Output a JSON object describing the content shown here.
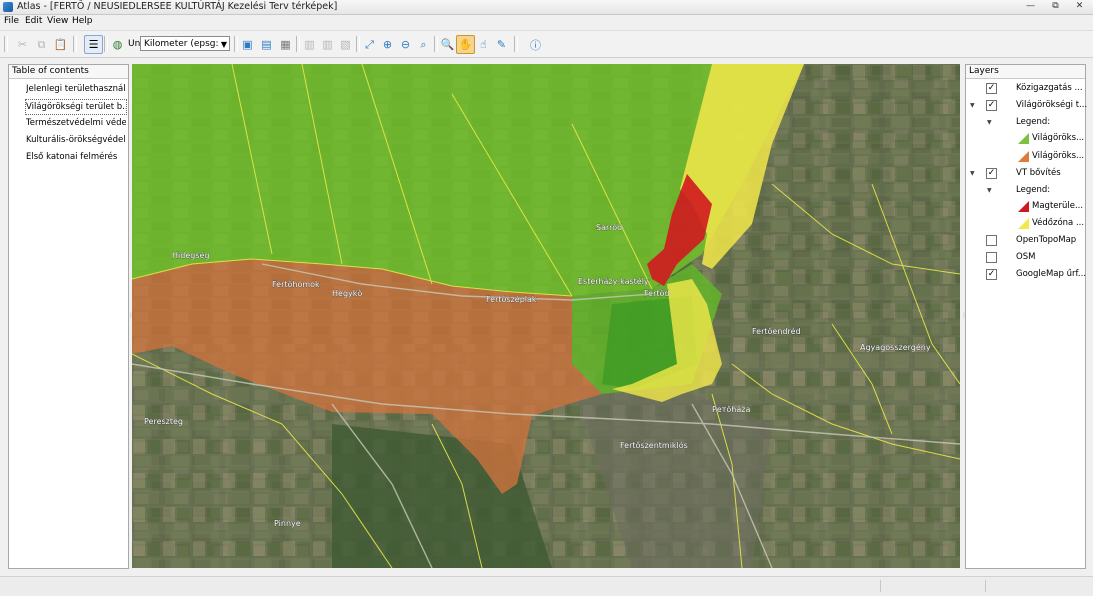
{
  "window": {
    "title": "Atlas - [FERTŐ / NEUSIEDLERSEE KULTÚRTÁJ Kezelési Terv térképek]",
    "controls": [
      "—",
      "⧉",
      "✕"
    ]
  },
  "menu": [
    "File",
    "Edit",
    "View",
    "Help"
  ],
  "toolbar": {
    "unit_label": "Unit:",
    "unit_value": "Kilometer (epsg:"
  },
  "toc": {
    "header": "Table of contents",
    "items": [
      "Jelenlegi területhasználat",
      "Világörökségi terület b...",
      "Természetvédelmi védettség",
      "Kulturális-örökségvédelem",
      "Első katonai felmérés"
    ]
  },
  "layers": {
    "header": "Layers",
    "rows": [
      {
        "label": "Közigazgatás ...",
        "checked": true
      },
      {
        "label": "Világörökségi t...",
        "checked": true
      },
      {
        "label": "Legend:"
      },
      {
        "label": "Világöröks...",
        "color": "#7cc242"
      },
      {
        "label": "Világöröks...",
        "color": "#e07a3a"
      },
      {
        "label": "VT bővítés",
        "checked": true
      },
      {
        "label": "Legend:"
      },
      {
        "label": "Magterüle...",
        "color": "#d0181f"
      },
      {
        "label": "Védőzóna ...",
        "color": "#f2e84a"
      },
      {
        "label": "OpenTopoMap",
        "checked": false
      },
      {
        "label": "OSM",
        "checked": false
      },
      {
        "label": "GoogleMap űrf...",
        "checked": true
      }
    ]
  },
  "map": {
    "labels": {
      "hidegseg": "Hidegség",
      "fertohomok": "Fertőhomok",
      "hegyko": "Hegykő",
      "sarrod": "Sarród",
      "fertoszeplak": "Fertőszéplak",
      "esterhazy": "Esterházy-kastély",
      "fertod": "Fertőd",
      "fertoendred": "Fertőendréd",
      "agyagosszergeny": "Agyagosszergény",
      "petohaza": "Pетőháza",
      "fertoszentmiklos": "Fertőszentmiklós",
      "pereszteg": "Pereszteg",
      "pinnye": "Pinnye"
    }
  }
}
